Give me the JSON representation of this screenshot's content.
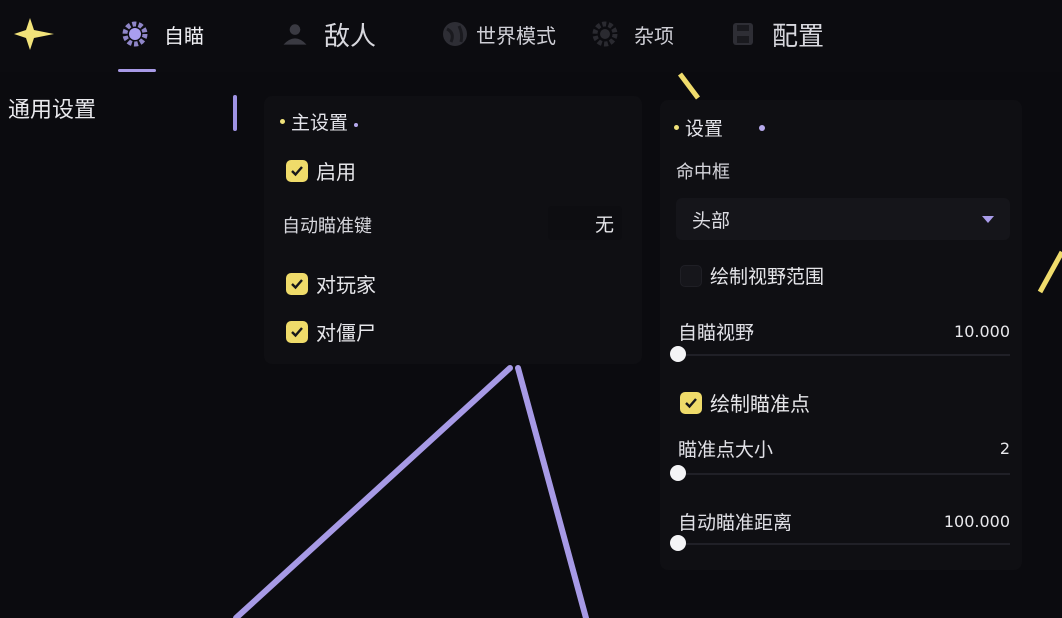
{
  "nav": {
    "tabs": [
      {
        "label": "自瞄",
        "icon": "gear-icon",
        "active": true
      },
      {
        "label": "敌人",
        "icon": "user-group-icon"
      },
      {
        "label": "世界模式",
        "icon": "globe-icon"
      },
      {
        "label": "杂项",
        "icon": "gear-icon"
      },
      {
        "label": "配置",
        "icon": "save-icon"
      }
    ]
  },
  "sidebar": {
    "items": [
      {
        "label": "通用设置",
        "active": true
      }
    ]
  },
  "main_settings": {
    "title": "主设置",
    "enable": {
      "label": "启用",
      "checked": true
    },
    "hotkey": {
      "label": "自动瞄准键",
      "value": "无"
    },
    "target_players": {
      "label": "对玩家",
      "checked": true
    },
    "target_zombies": {
      "label": "对僵尸",
      "checked": true
    }
  },
  "settings": {
    "title": "设置",
    "hitbox": {
      "label": "命中框",
      "value": "头部"
    },
    "draw_fov": {
      "label": "绘制视野范围",
      "checked": false
    },
    "fov": {
      "label": "自瞄视野",
      "value": "10.000",
      "fraction": 0.0
    },
    "draw_aim_point": {
      "label": "绘制瞄准点",
      "checked": true
    },
    "aim_point_size": {
      "label": "瞄准点大小",
      "value": "2",
      "fraction": 0.0
    },
    "aim_distance": {
      "label": "自动瞄准距离",
      "value": "100.000",
      "fraction": 0.0
    }
  },
  "colors": {
    "accent": "#f0dc6c",
    "lavender": "#a79ae6",
    "background": "#0b0b0f"
  }
}
